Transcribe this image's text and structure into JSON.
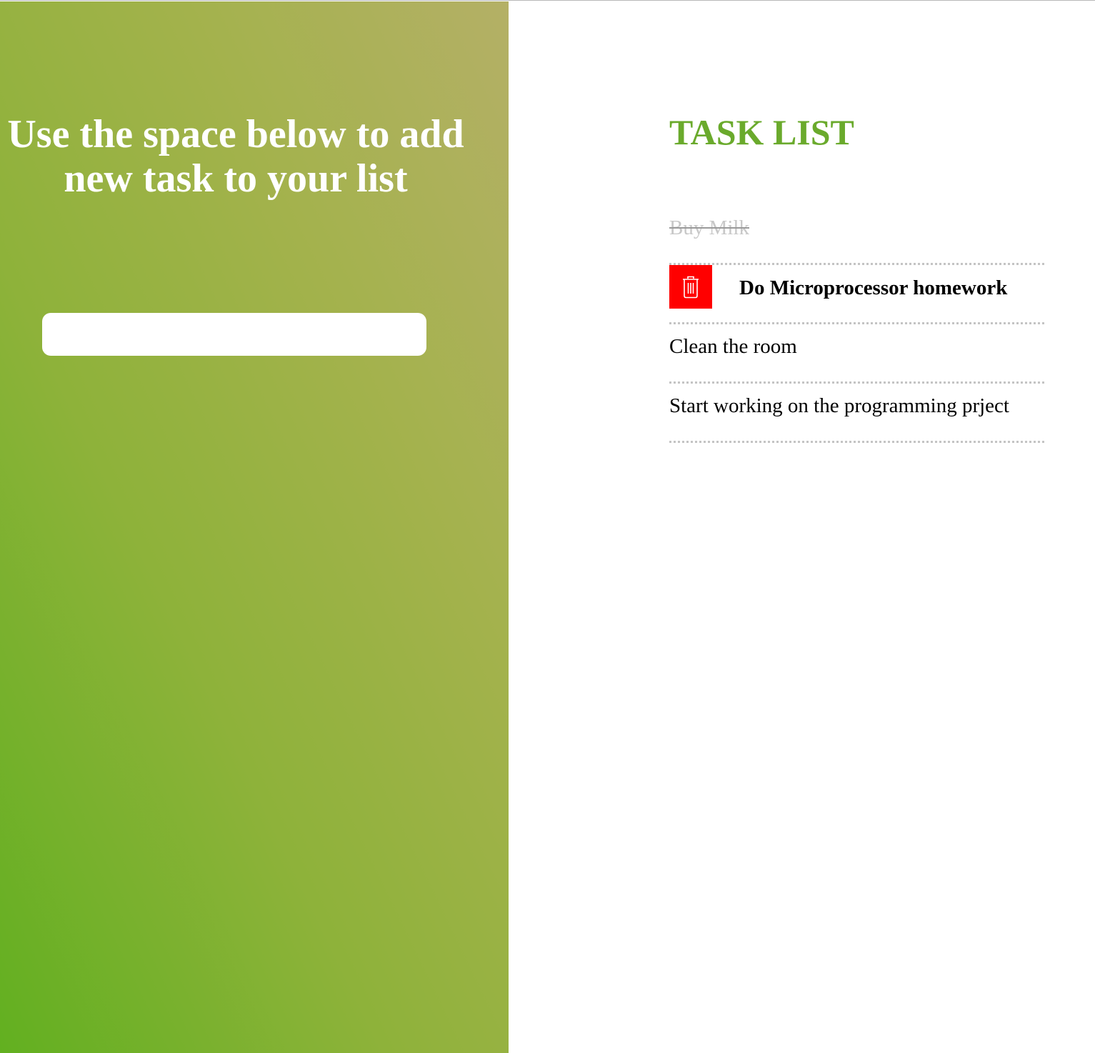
{
  "form": {
    "heading": "Use the space below to add new task to your list",
    "input_value": "",
    "input_placeholder": ""
  },
  "task_list": {
    "title": "TASK LIST",
    "items": [
      {
        "label": "Buy Milk",
        "completed": true
      },
      {
        "label": "Do Microprocessor homework",
        "completed": false,
        "hovered": true
      },
      {
        "label": "Clean the room",
        "completed": false
      },
      {
        "label": "Start working on the programming prject",
        "completed": false
      }
    ]
  },
  "colors": {
    "gradient_start": "#62b020",
    "gradient_end": "#b4b066",
    "title_green": "#6aaa2c",
    "delete_red": "#ff0000",
    "divider": "#c4c4c4"
  },
  "icons": {
    "delete": "trash-icon"
  }
}
